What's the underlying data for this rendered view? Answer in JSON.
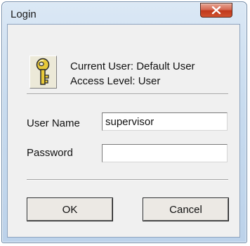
{
  "window": {
    "title": "Login",
    "close_symbol": "X"
  },
  "info": {
    "icon": "key-icon",
    "current_user": "Current User: Default User",
    "access_level": "Access Level: User"
  },
  "form": {
    "username_label": "User Name",
    "username_value": "supervisor",
    "password_label": "Password",
    "password_value": ""
  },
  "buttons": {
    "ok": "OK",
    "cancel": "Cancel"
  },
  "colors": {
    "frame": "#c9dcef",
    "client": "#f0f0f0",
    "close_button": "#c7472a",
    "key_fill": "#e8c93a"
  }
}
